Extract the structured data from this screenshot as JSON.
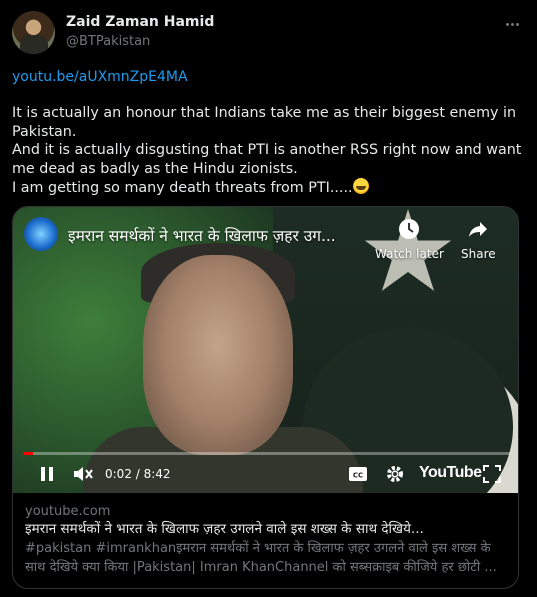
{
  "author": {
    "name": "Zaid Zaman Hamid",
    "handle": "@BTPakistan"
  },
  "tweet": {
    "link": "youtu.be/aUXmnZpE4MA",
    "lines": [
      "It is actually an honour that Indians take me as their biggest enemy in",
      "Pakistan.",
      "And it is actually disgusting that PTI is another RSS right now and want",
      "me dead as badly as the Hindu zionists.",
      "I am getting so many death threats from PTI....."
    ]
  },
  "video": {
    "title": "इमरान समर्थकों ने भारत के खिलाफ ज़हर उग...",
    "watch_later_label": "Watch later",
    "share_label": "Share",
    "time": "0:02 / 8:42",
    "progress_fraction": 0.004,
    "youtube_label": "YouTube"
  },
  "card": {
    "domain": "youtube.com",
    "title": "इमरान समर्थकों ने भारत के खिलाफ ज़हर उगलने वाले इस शख्स के साथ देखिये...",
    "description": "#pakistan #imrankhanइमरान समर्थकों ने भारत के खिलाफ ज़हर उगलने वाले इस शख्स के साथ देखिये क्या किया |Pakistan| Imran KhanChannel को सब्सक्राइब कीजिये हर छोटी ..."
  },
  "icons": {
    "more": "more-icon",
    "emoji": "grinning-face-icon",
    "clock": "clock-icon",
    "share": "share-icon",
    "pause": "pause-icon",
    "mute": "mute-icon",
    "captions": "captions-icon",
    "settings": "gear-icon",
    "fullscreen": "fullscreen-icon"
  },
  "colors": {
    "link": "#1d9bf0",
    "progress": "#ff0000",
    "muted_text": "#71767b"
  }
}
